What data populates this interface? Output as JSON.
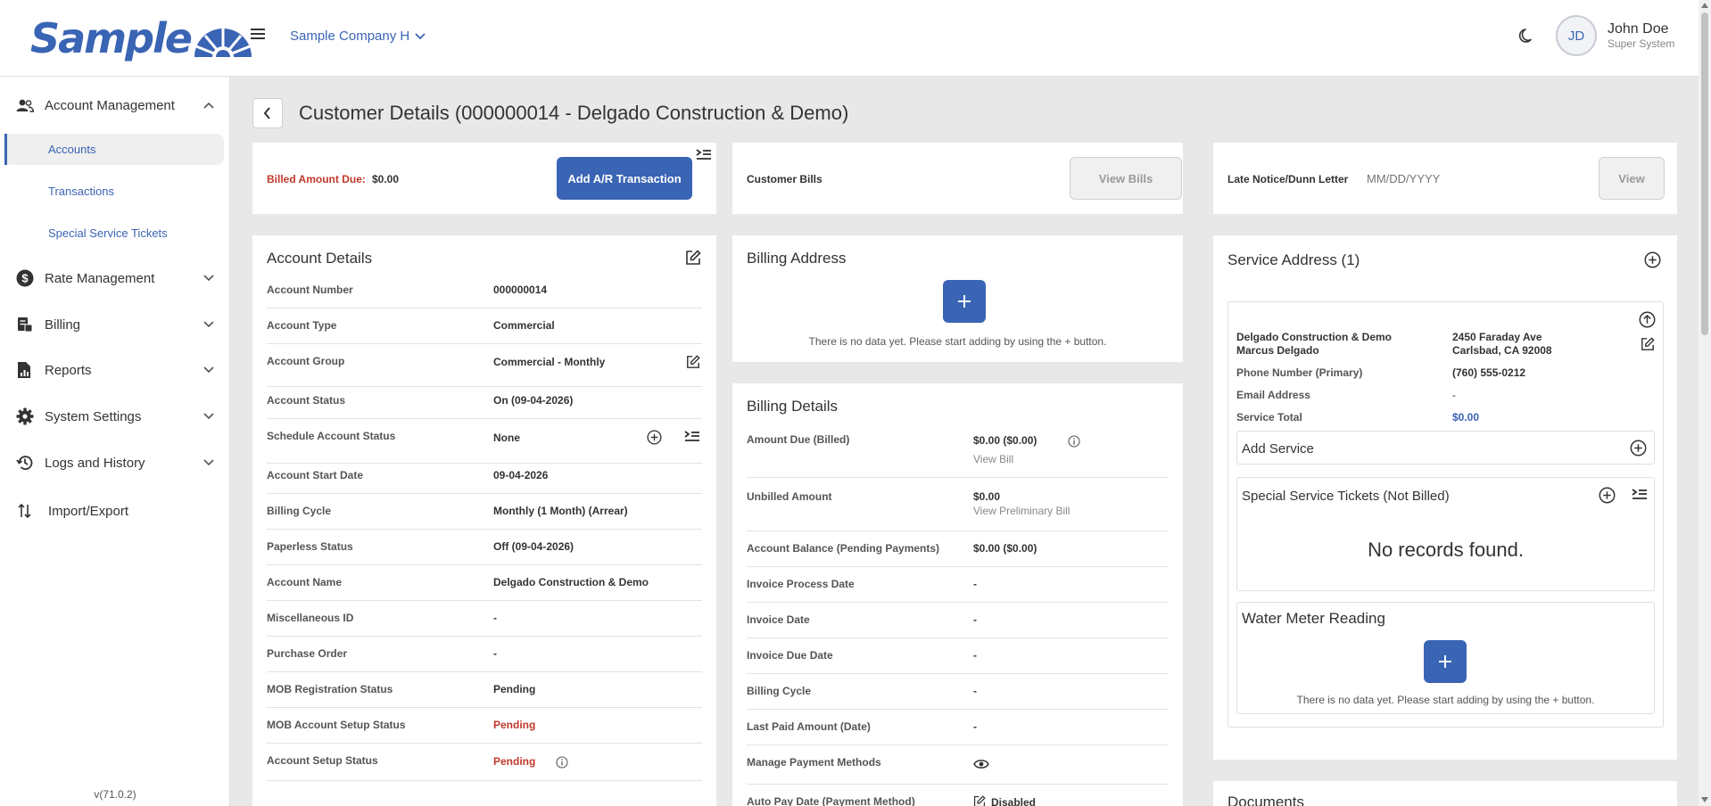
{
  "header": {
    "logo_text": "Sample",
    "company": "Sample Company H",
    "user_name": "John Doe",
    "user_role": "Super System",
    "user_initials": "JD"
  },
  "sidebar": {
    "items": [
      {
        "label": "Account Management",
        "icon": "users-icon"
      },
      {
        "label": "Rate Management",
        "icon": "dollar-icon"
      },
      {
        "label": "Billing",
        "icon": "billing-icon"
      },
      {
        "label": "Reports",
        "icon": "reports-icon"
      },
      {
        "label": "System Settings",
        "icon": "gear-icon"
      },
      {
        "label": "Logs and History",
        "icon": "history-icon"
      },
      {
        "label": "Import/Export",
        "icon": "import-export-icon"
      }
    ],
    "subitems": [
      "Accounts",
      "Transactions",
      "Special Service Tickets"
    ],
    "version": "v(71.0.2)"
  },
  "page": {
    "title": "Customer Details (000000014 - Delgado Construction & Demo)"
  },
  "billed": {
    "label": "Billed Amount Due:",
    "value": "$0.00",
    "button": "Add A/R Transaction"
  },
  "bills": {
    "label": "Customer Bills",
    "button": "View Bills"
  },
  "late_notice": {
    "label": "Late Notice/Dunn Letter",
    "placeholder": "MM/DD/YYYY",
    "button": "View"
  },
  "account_details": {
    "title": "Account Details",
    "rows": [
      {
        "label": "Account Number",
        "value": "000000014"
      },
      {
        "label": "Account Type",
        "value": "Commercial"
      },
      {
        "label": "Account Group",
        "value": "Commercial - Monthly"
      },
      {
        "label": "Account Status",
        "value": "On (09-04-2026)"
      },
      {
        "label": "Schedule Account Status",
        "value": "None"
      },
      {
        "label": "Account Start Date",
        "value": "09-04-2026"
      },
      {
        "label": "Billing Cycle",
        "value": "Monthly (1 Month) (Arrear)"
      },
      {
        "label": "Paperless Status",
        "value": "Off (09-04-2026)"
      },
      {
        "label": "Account Name",
        "value": "Delgado Construction & Demo"
      },
      {
        "label": "Miscellaneous ID",
        "value": "-"
      },
      {
        "label": "Purchase Order",
        "value": "-"
      },
      {
        "label": "MOB Registration Status",
        "value": "Pending"
      },
      {
        "label": "MOB Account Setup Status",
        "value": "Pending"
      },
      {
        "label": "Account Setup Status",
        "value": "Pending"
      }
    ]
  },
  "billing_address": {
    "title": "Billing Address",
    "empty": "There is no data yet. Please start adding by using the + button."
  },
  "billing_details": {
    "title": "Billing Details",
    "rows": [
      {
        "label": "Amount Due (Billed)",
        "value": "$0.00 ($0.00)",
        "sub": "View Bill"
      },
      {
        "label": "Unbilled Amount",
        "value": "$0.00",
        "sub": "View Preliminary Bill"
      },
      {
        "label": "Account Balance (Pending Payments)",
        "value": "$0.00 ($0.00)"
      },
      {
        "label": "Invoice Process Date",
        "value": "-"
      },
      {
        "label": "Invoice Date",
        "value": "-"
      },
      {
        "label": "Invoice Due Date",
        "value": "-"
      },
      {
        "label": "Billing Cycle",
        "value": "-"
      },
      {
        "label": "Last Paid Amount (Date)",
        "value": "-"
      },
      {
        "label": "Manage Payment Methods",
        "value": ""
      },
      {
        "label": "Auto Pay Date (Payment Method)",
        "value": "Disabled"
      }
    ]
  },
  "service_address": {
    "title": "Service Address (1)",
    "name_line1": "Delgado Construction & Demo",
    "name_line2": "Marcus Delgado",
    "addr_line1": "2450 Faraday Ave",
    "addr_line2": "Carlsbad, CA 92008",
    "phone_label": "Phone Number (Primary)",
    "phone": "(760) 555-0212",
    "email_label": "Email Address",
    "email": "-",
    "total_label": "Service Total",
    "total": "$0.00",
    "add_service": "Add Service",
    "tickets_title": "Special Service Tickets (Not Billed)",
    "no_records": "No records found.",
    "water_title": "Water Meter Reading",
    "water_empty": "There is no data yet. Please start adding by using the + button."
  },
  "documents": {
    "title": "Documents"
  },
  "colors": {
    "accent": "#3a64b4",
    "danger": "#c0392b",
    "background": "#e8e8e8"
  }
}
